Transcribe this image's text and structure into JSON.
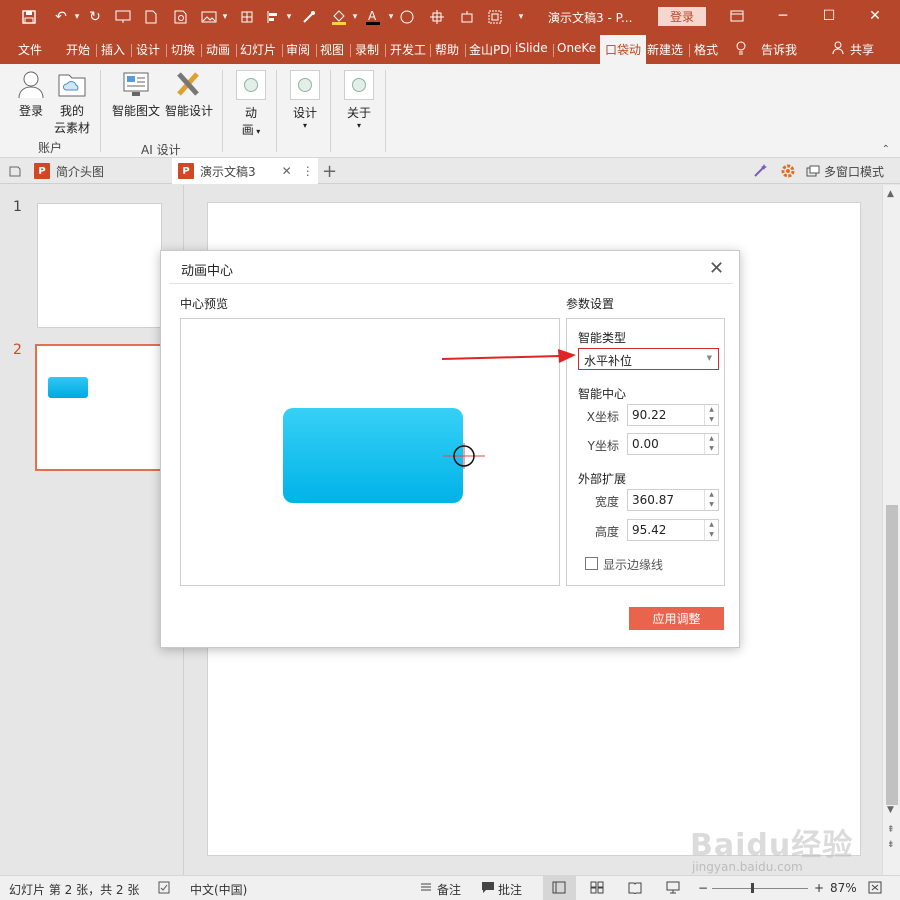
{
  "window": {
    "title": "演示文稿3 - P...",
    "login_label": "登录"
  },
  "ribbon_tabs": [
    {
      "label": "文件"
    },
    {
      "label": "开始"
    },
    {
      "label": "插入"
    },
    {
      "label": "设计"
    },
    {
      "label": "切换"
    },
    {
      "label": "动画"
    },
    {
      "label": "幻灯片"
    },
    {
      "label": "审阅"
    },
    {
      "label": "视图"
    },
    {
      "label": "录制"
    },
    {
      "label": "开发工"
    },
    {
      "label": "帮助"
    },
    {
      "label": "金山PD"
    },
    {
      "label": "iSlide"
    },
    {
      "label": "OneKe"
    },
    {
      "label": "口袋动"
    },
    {
      "label": "新建选"
    },
    {
      "label": "格式"
    }
  ],
  "tell_me": "告诉我",
  "share": "共享",
  "ribbon": {
    "login": "登录",
    "my_cloud_1": "我的",
    "my_cloud_2": "云素材",
    "group_account": "账户",
    "smart_graphic": "智能图文",
    "smart_design": "智能设计",
    "group_ai": "AI 设计",
    "anim_1": "动",
    "anim_2": "画",
    "design": "设计",
    "about": "关于"
  },
  "doc_tabs": {
    "tab1": "简介头图",
    "tab2": "演示文稿3",
    "multi_window": "多窗口模式"
  },
  "thumbs": [
    {
      "num": "1"
    },
    {
      "num": "2"
    }
  ],
  "dialog": {
    "title": "动画中心",
    "preview_label": "中心预览",
    "params_label": "参数设置",
    "smart_type_label": "智能类型",
    "smart_type_value": "水平补位",
    "smart_center_label": "智能中心",
    "x_label": "X坐标",
    "x_value": "90.22",
    "y_label": "Y坐标",
    "y_value": "0.00",
    "external_label": "外部扩展",
    "width_label": "宽度",
    "width_value": "360.87",
    "height_label": "高度",
    "height_value": "95.42",
    "show_edge_label": "显示边缘线",
    "apply_label": "应用调整"
  },
  "status": {
    "slide_info": "幻灯片 第 2 张，共 2 张",
    "language": "中文(中国)",
    "notes": "备注",
    "comments": "批注",
    "zoom": "87%"
  },
  "watermark": {
    "brand": "Baidu经验",
    "url": "jingyan.baidu.com"
  },
  "colors": {
    "accent": "#b7472a",
    "apply_button": "#e9644d",
    "highlight_red": "#d22b2b",
    "shape_blue": "#00b3e8"
  }
}
